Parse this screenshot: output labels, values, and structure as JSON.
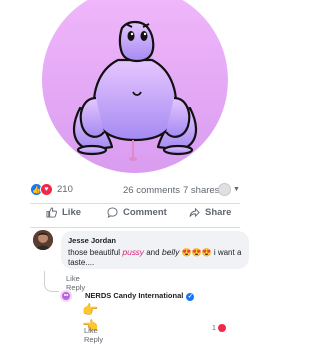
{
  "post": {
    "reaction_count": "210",
    "comments_count": "26 comments",
    "shares_count": "7 shares"
  },
  "actions": {
    "like": "Like",
    "comment": "Comment",
    "share": "Share"
  },
  "comment": {
    "author": "Jesse Jordan",
    "text_before": "those beautiful ",
    "hand_word_1": "pussy",
    "text_and": " and ",
    "hand_word_2": "belly",
    "emoji": " 😍😍😍",
    "text_after": "i want a taste....",
    "like_label": "Like",
    "reply_label": "Reply"
  },
  "reply": {
    "author": "NERDS Candy International",
    "verified_mark": "✓",
    "emoji": "👉👈",
    "like_label": "Like",
    "reply_label": "Reply",
    "reaction_count": "1"
  },
  "colors": {
    "accent": "#1877f2",
    "love": "#f02849",
    "circle_fill": "#e6a6f5",
    "text_muted": "#606770"
  }
}
